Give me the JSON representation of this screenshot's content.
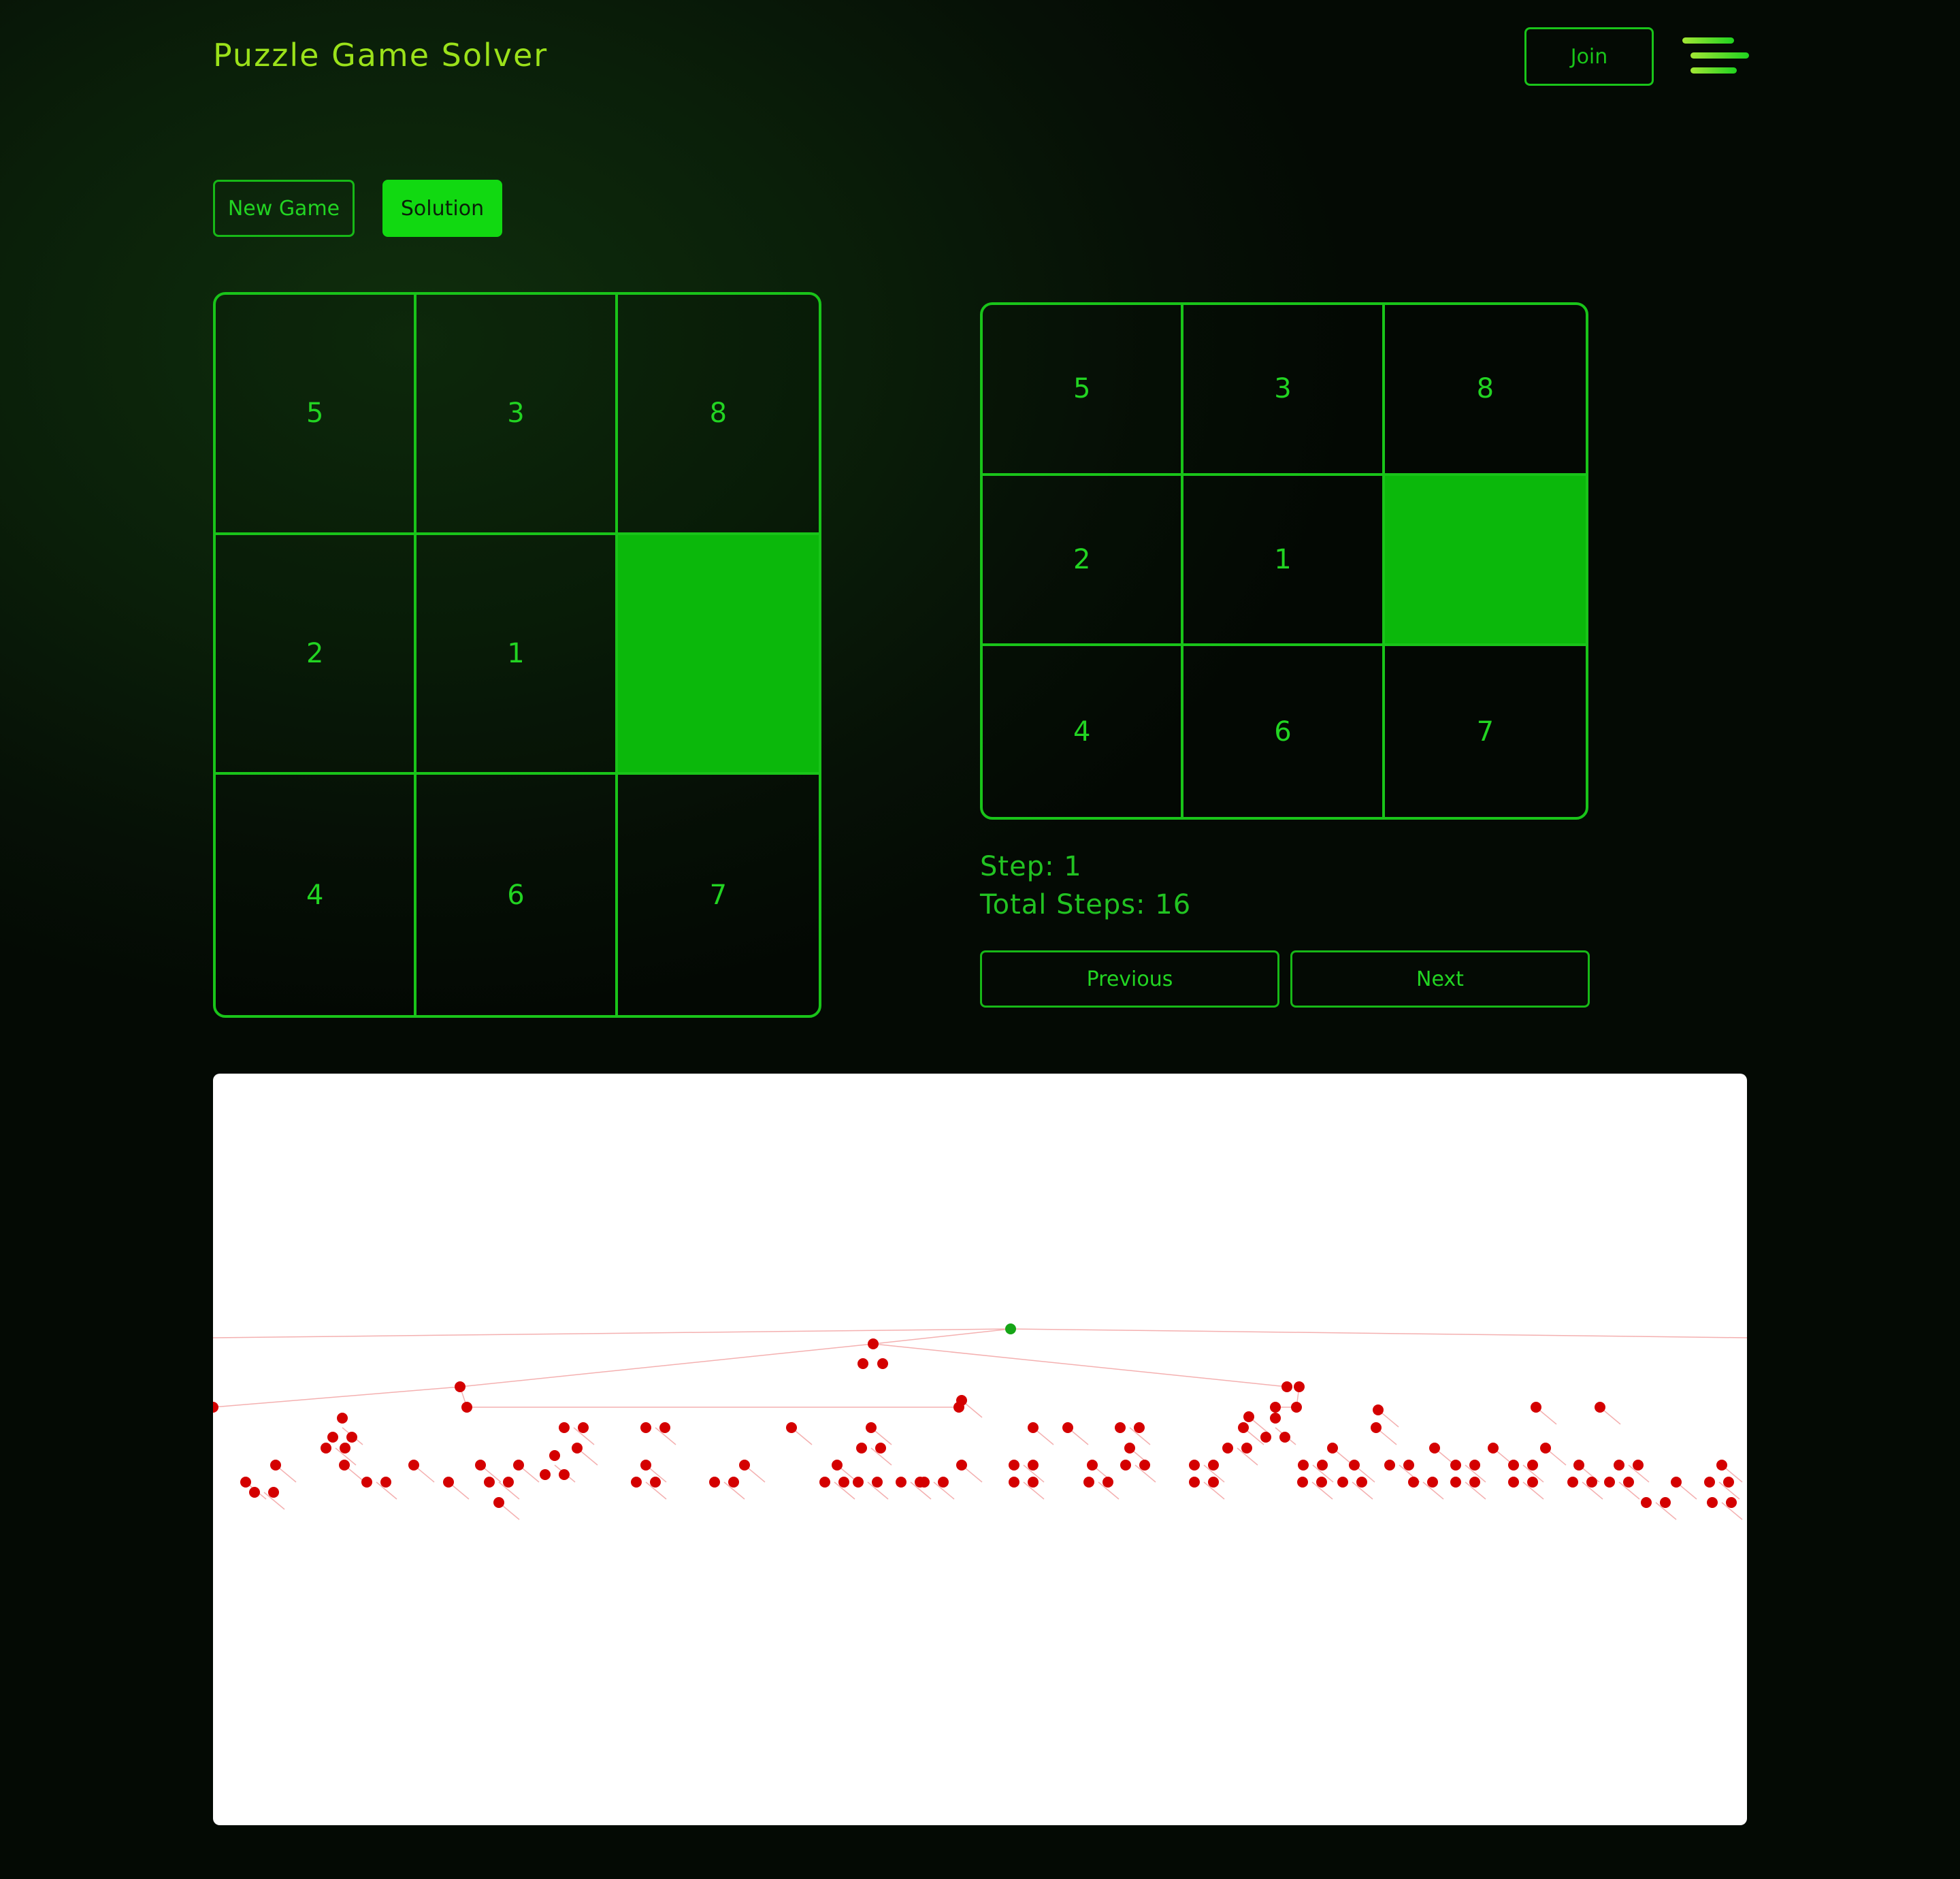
{
  "header": {
    "title": "Puzzle Game Solver",
    "join_label": "Join",
    "menu_icon": "hamburger-menu-icon"
  },
  "controls": {
    "new_game_label": "New Game",
    "solution_label": "Solution"
  },
  "board": {
    "tiles": [
      "5",
      "3",
      "8",
      "2",
      "1",
      "",
      "4",
      "6",
      "7"
    ]
  },
  "solution_board": {
    "tiles": [
      "5",
      "3",
      "8",
      "2",
      "1",
      "",
      "4",
      "6",
      "7"
    ]
  },
  "steps": {
    "step_text": "Step: 1",
    "total_text": "Total Steps: 16",
    "previous_label": "Previous",
    "next_label": "Next"
  },
  "colors": {
    "accent": "#19c419",
    "blank_tile": "#0bb80b",
    "root_node": "#16a516",
    "node": "#d40000",
    "edge": "#f4b0b0"
  }
}
